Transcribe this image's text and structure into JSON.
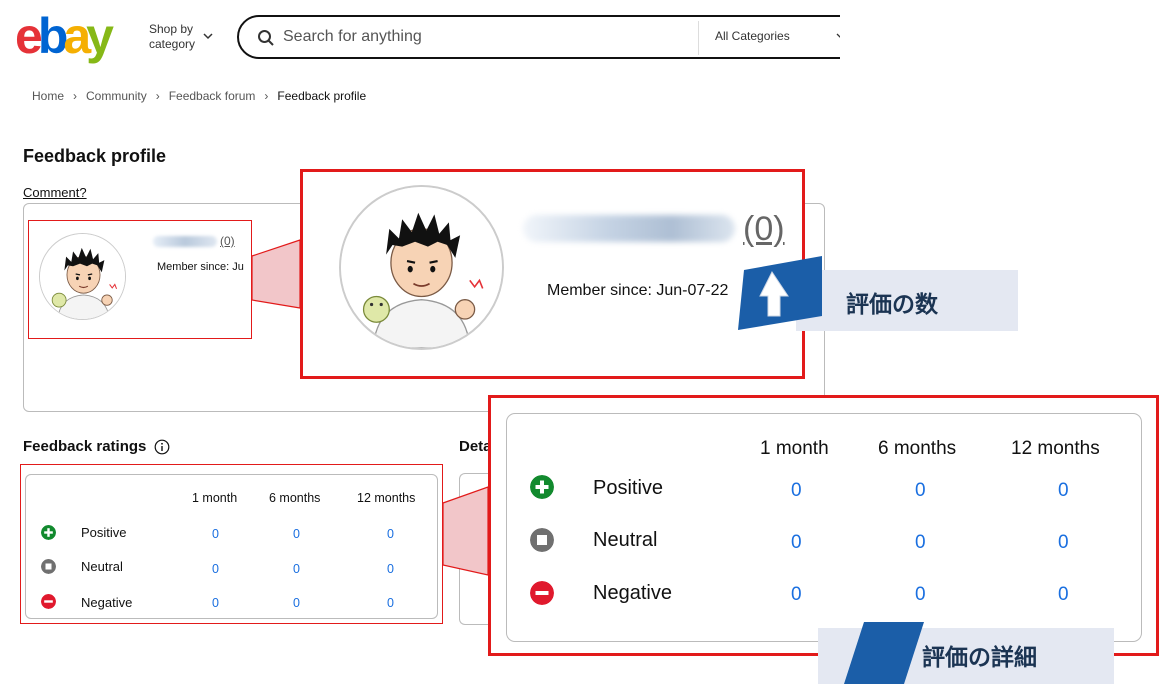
{
  "header": {
    "logo_letters": [
      "e",
      "b",
      "a",
      "y"
    ],
    "logo_colors": [
      "#e53238",
      "#0064d2",
      "#f5af02",
      "#86b817"
    ],
    "shop_by_line1": "Shop by",
    "shop_by_line2": "category",
    "search_placeholder": "Search for anything",
    "category_select": "All Categories"
  },
  "breadcrumb": [
    "Home",
    "Community",
    "Feedback forum",
    "Feedback profile"
  ],
  "page_title": "Feedback profile",
  "comment_link": "Comment?",
  "profile": {
    "feedback_count": "(0)",
    "member_since_small": "Member since: Ju",
    "member_since_big": "Member since: Jun-07-22"
  },
  "ratings": {
    "title": "Feedback ratings",
    "detail_title_partial": "Deta",
    "columns": [
      "1 month",
      "6 months",
      "12 months"
    ],
    "rows": [
      {
        "label": "Positive",
        "icon": "plus-circle-icon",
        "color": "#128a2e",
        "values": [
          "0",
          "0",
          "0"
        ]
      },
      {
        "label": "Neutral",
        "icon": "square-circle-icon",
        "color": "#707070",
        "values": [
          "0",
          "0",
          "0"
        ]
      },
      {
        "label": "Negative",
        "icon": "minus-circle-icon",
        "color": "#e0192d",
        "values": [
          "0",
          "0",
          "0"
        ]
      }
    ]
  },
  "annotations": {
    "count_label": "評価の数",
    "detail_label": "評価の詳細",
    "highlight_color": "#e21a1a",
    "badge_blue": "#1b5ea8"
  }
}
